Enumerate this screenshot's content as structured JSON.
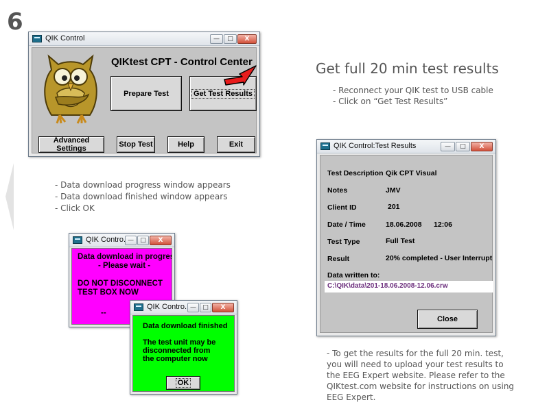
{
  "step_number": "6",
  "main_window": {
    "title": "QIK Control",
    "heading": "QIKtest CPT - Control Center",
    "buttons": {
      "prepare": "Prepare Test",
      "get_results": "Get Test Results",
      "advanced": "Advanced Settings",
      "stop": "Stop Test",
      "help": "Help",
      "exit": "Exit"
    }
  },
  "window_controls": {
    "minimize": "—",
    "maximize": "□",
    "close": "X"
  },
  "right_heading": "Get full 20 min test results",
  "right_instructions": [
    "- Reconnect your QIK test to USB cable",
    "- Click on “Get Test Results”"
  ],
  "left_instructions": [
    "- Data download progress window appears",
    "- Data download finished window appears",
    "- Click OK"
  ],
  "progress_window": {
    "title": "QIK Contro...",
    "lines": [
      "Data download in progres",
      "- Please wait -",
      "DO NOT DISCONNECT",
      "TEST BOX NOW",
      "--"
    ]
  },
  "finished_window": {
    "title": "QIK Contro...",
    "lines": [
      "Data download finished",
      "The test unit may be",
      "disconnected from",
      "the computer now"
    ],
    "ok_button": "OK"
  },
  "results_window": {
    "title": "QIK Control:Test Results",
    "fields": [
      {
        "label": "Test Description",
        "value": "Qik CPT Visual"
      },
      {
        "label": "Notes",
        "value": "JMV"
      },
      {
        "label": "Client ID",
        "value": "201"
      },
      {
        "label": "Date / Time",
        "value": "18.06.2008      12:06"
      },
      {
        "label": "Test Type",
        "value": "Full Test"
      },
      {
        "label": "Result",
        "value": "20% completed - User Interrupt"
      }
    ],
    "data_written_label": "Data written to:",
    "data_path": "C:\\QIK\\data\\201-18.06.2008-12.06.crw",
    "close_button": "Close"
  },
  "bottom_note": [
    "- To get the results for the full 20 min. test,",
    "you will need to upload your test results to",
    "the EEG Expert website. Please refer to the",
    "QIKtest.com website for instructions on using",
    "EEG Expert."
  ]
}
